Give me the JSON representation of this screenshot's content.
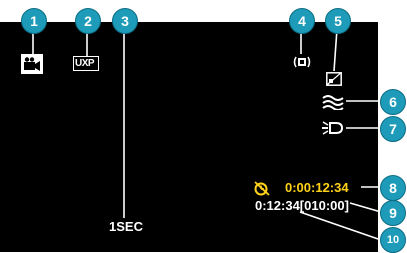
{
  "colors": {
    "screen_bg": "#000000",
    "osd_text": "#ffffff",
    "time_text": "#ffd21a",
    "callout": "#1d9bb8"
  },
  "callouts": [
    "1",
    "2",
    "3",
    "4",
    "5",
    "6",
    "7",
    "8",
    "9",
    "10"
  ],
  "osd": {
    "video_mode_icon": "video-camera-icon",
    "quality_label": "UXP",
    "shutter_speed": "1SEC",
    "image_stabilizer_icon": "image-stabilizer-icon",
    "backlight_icon": "backlight-compensation-icon",
    "wind_cut_icon": "wind-cut-icon",
    "light_icon": "video-light-icon",
    "timer_icon": "time-lapse-icon",
    "record_time": "0:00:12:34",
    "remaining_time": "0:12:34[010:00]"
  }
}
